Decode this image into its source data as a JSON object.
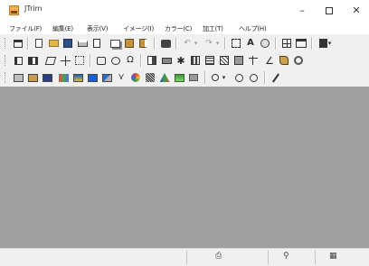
{
  "window": {
    "title": "JTrim",
    "minimize_glyph": "–",
    "maximize_glyph": "",
    "close_glyph": "✕"
  },
  "menu": {
    "items": [
      {
        "label": "ファイル(F)"
      },
      {
        "label": "編集(E)"
      },
      {
        "label": "表示(V)"
      },
      {
        "label": "イメージ(I)"
      },
      {
        "label": "カラー(C)"
      },
      {
        "label": "加工(T)"
      },
      {
        "label": "ヘルプ(H)"
      }
    ]
  },
  "toolbar1": {
    "icons": [
      "new-image",
      "new-doc",
      "open-folder",
      "save-disk",
      "print",
      "print-preview",
      "copy",
      "paste",
      "paste-new",
      "sep",
      "recapture",
      "sep",
      "undo",
      "undo-dropdown",
      "redo",
      "redo-dropdown",
      "sep",
      "resize",
      "text",
      "globe",
      "grid",
      "window-frame",
      "sep",
      "more-dropdown"
    ],
    "glyphs": {
      "undo": "↶",
      "redo": "↷",
      "undo-dropdown": "▾",
      "redo-dropdown": "▾",
      "text": "A",
      "more-dropdown": "▾"
    }
  },
  "toolbar2": {
    "icons": [
      "rotate",
      "flip-horizontal",
      "transform-x",
      "adjust-plus",
      "select-frame",
      "sep",
      "rectangle-select",
      "lasso",
      "omega",
      "sep",
      "brightness",
      "contrast",
      "sun-effect",
      "mosaic",
      "blur",
      "sharpen",
      "edge",
      "filter",
      "pen",
      "brush",
      "circle-tool"
    ],
    "glyphs": {
      "omega": "Ω",
      "sun-effect": "✱",
      "pen": "∠"
    }
  },
  "toolbar3": {
    "icons": [
      "gray",
      "sepia",
      "color-tone",
      "gamma",
      "color-balance",
      "hue",
      "histogram",
      "levels",
      "swirl",
      "noise",
      "effects",
      "shadow",
      "frame",
      "sep",
      "zoom-in",
      "zoom-dropdown",
      "zoom-plus",
      "zoom-minus",
      "sep",
      "eyedropper"
    ],
    "glyphs": {
      "zoom-dropdown": "▾",
      "histogram": "⋎"
    }
  },
  "statusbar": {
    "icons": [
      "image-info-icon",
      "zoom-icon",
      "grid-icon"
    ],
    "glyphs": {
      "image-info-icon": "⎙",
      "zoom-icon": "⚲",
      "grid-icon": "▦"
    }
  },
  "colors": {
    "workspace": "#a0a0a0",
    "chrome": "#f0f0f0",
    "titlebar": "#ffffff"
  }
}
